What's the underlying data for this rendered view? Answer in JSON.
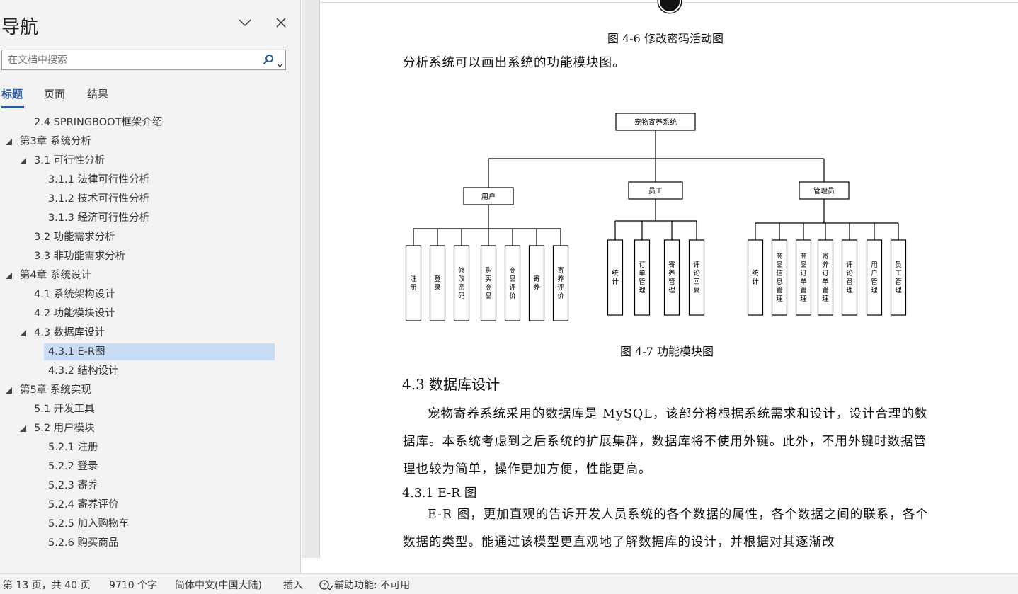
{
  "nav": {
    "title": "导航",
    "search_placeholder": "在文档中搜索",
    "tabs": [
      {
        "label": "标题",
        "active": true
      },
      {
        "label": "页面",
        "active": false
      },
      {
        "label": "结果",
        "active": false
      }
    ],
    "tree": [
      {
        "label": "2.4 SPRINGBOOT框架介绍",
        "level": 2,
        "expanded": null
      },
      {
        "label": "第3章 系统分析",
        "level": 1,
        "expanded": true
      },
      {
        "label": "3.1 可行性分析",
        "level": 2,
        "expanded": true
      },
      {
        "label": "3.1.1 法律可行性分析",
        "level": 3,
        "expanded": null
      },
      {
        "label": "3.1.2 技术可行性分析",
        "level": 3,
        "expanded": null
      },
      {
        "label": "3.1.3 经济可行性分析",
        "level": 3,
        "expanded": null
      },
      {
        "label": "3.2 功能需求分析",
        "level": 2,
        "expanded": null
      },
      {
        "label": "3.3 非功能需求分析",
        "level": 2,
        "expanded": null
      },
      {
        "label": "第4章 系统设计",
        "level": 1,
        "expanded": true
      },
      {
        "label": "4.1 系统架构设计",
        "level": 2,
        "expanded": null
      },
      {
        "label": "4.2 功能模块设计",
        "level": 2,
        "expanded": null
      },
      {
        "label": "4.3 数据库设计",
        "level": 2,
        "expanded": true
      },
      {
        "label": "4.3.1 E-R图",
        "level": 3,
        "expanded": null,
        "selected": true
      },
      {
        "label": "4.3.2 结构设计",
        "level": 3,
        "expanded": null
      },
      {
        "label": "第5章 系统实现",
        "level": 1,
        "expanded": true
      },
      {
        "label": "5.1 开发工具",
        "level": 2,
        "expanded": null
      },
      {
        "label": "5.2 用户模块",
        "level": 2,
        "expanded": true
      },
      {
        "label": "5.2.1 注册",
        "level": 3,
        "expanded": null
      },
      {
        "label": "5.2.2 登录",
        "level": 3,
        "expanded": null
      },
      {
        "label": "5.2.3 寄养",
        "level": 3,
        "expanded": null
      },
      {
        "label": "5.2.4 寄养评价",
        "level": 3,
        "expanded": null
      },
      {
        "label": "5.2.5 加入购物车",
        "level": 3,
        "expanded": null
      },
      {
        "label": "5.2.6 购买商品",
        "level": 3,
        "expanded": null
      }
    ]
  },
  "doc": {
    "caption_top": "图 4-6 修改密码活动图",
    "intro": "分析系统可以画出系统的功能模块图。",
    "diagram": {
      "root": "宠物寄养系统",
      "groups": [
        {
          "name": "用户",
          "children": [
            "注册",
            "登录",
            "修改密码",
            "购买商品",
            "商品评价",
            "寄养",
            "寄养评价"
          ]
        },
        {
          "name": "员工",
          "children": [
            "统计",
            "订单管理",
            "寄养管理",
            "评论回复"
          ]
        },
        {
          "name": "管理员",
          "children": [
            "统计",
            "商品信息管理",
            "商品订单管理",
            "寄养订单管理",
            "评论管理",
            "用户管理",
            "员工管理"
          ]
        }
      ]
    },
    "caption_fig": "图 4-7 功能模块图",
    "h2": "4.3 数据库设计",
    "para1": "宠物寄养系统采用的数据库是 MySQL，该部分将根据系统需求和设计，设计合理的数据库。本系统考虑到之后系统的扩展集群，数据库将不使用外键。此外，不用外键时数据管理也较为简单，操作更加方便，性能更高。",
    "h3": "4.3.1 E-R 图",
    "para2": "E-R 图，更加直观的告诉开发人员系统的各个数据的属性，各个数据之间的联系，各个数据的类型。能通过该模型更直观地了解数据库的设计，并根据对其逐渐改"
  },
  "status": {
    "page": "第 13 页，共 40 页",
    "words": "9710 个字",
    "language": "简体中文(中国大陆)",
    "mode": "插入",
    "accessibility": "辅助功能: 不可用"
  }
}
